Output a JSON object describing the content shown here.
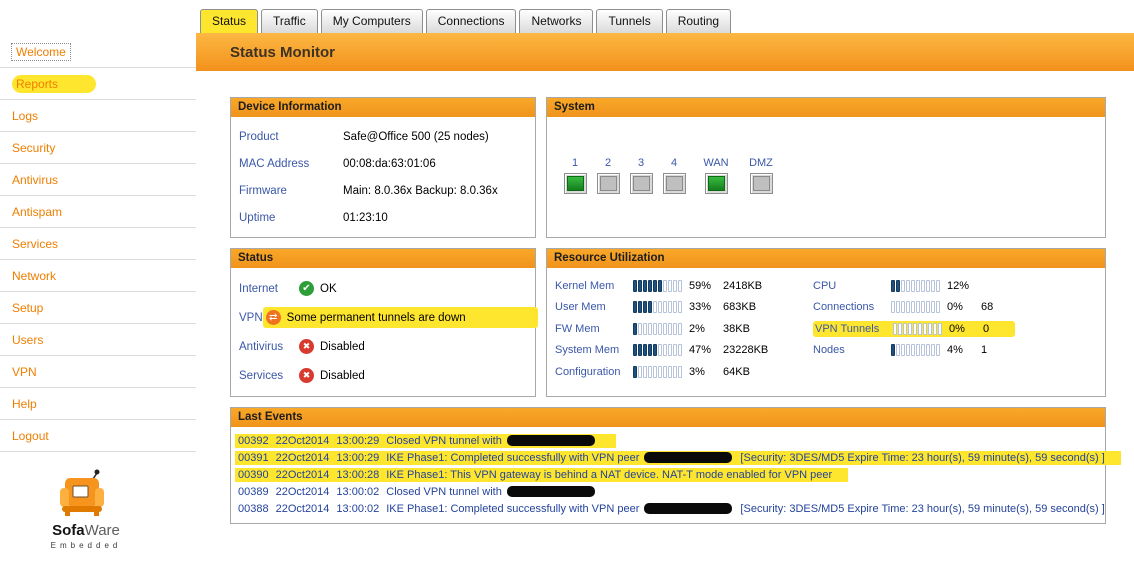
{
  "page_title": "Status Monitor",
  "sidebar": {
    "items": [
      {
        "label": "Welcome",
        "focused": true,
        "highlighted": false
      },
      {
        "label": "Reports",
        "focused": false,
        "highlighted": true
      },
      {
        "label": "Logs"
      },
      {
        "label": "Security"
      },
      {
        "label": "Antivirus"
      },
      {
        "label": "Antispam"
      },
      {
        "label": "Services"
      },
      {
        "label": "Network"
      },
      {
        "label": "Setup"
      },
      {
        "label": "Users"
      },
      {
        "label": "VPN"
      },
      {
        "label": "Help"
      },
      {
        "label": "Logout"
      }
    ],
    "logo": {
      "brand_bold": "Sofa",
      "brand_rest": "Ware",
      "subtitle": "Embedded"
    }
  },
  "tabs": [
    {
      "label": "Status",
      "active": true,
      "highlighted": true
    },
    {
      "label": "Traffic"
    },
    {
      "label": "My Computers"
    },
    {
      "label": "Connections"
    },
    {
      "label": "Networks"
    },
    {
      "label": "Tunnels"
    },
    {
      "label": "Routing"
    }
  ],
  "device_information": {
    "title": "Device Information",
    "rows": [
      {
        "label": "Product",
        "value": "Safe@Office 500 (25 nodes)"
      },
      {
        "label": "MAC Address",
        "value": "00:08:da:63:01:06"
      },
      {
        "label": "Firmware",
        "value": "Main: 8.0.36x Backup: 8.0.36x"
      },
      {
        "label": "Uptime",
        "value": "01:23:10"
      }
    ]
  },
  "system": {
    "title": "System",
    "ports": [
      {
        "label": "1",
        "active": true
      },
      {
        "label": "2",
        "active": false
      },
      {
        "label": "3",
        "active": false
      },
      {
        "label": "4",
        "active": false
      },
      {
        "label": "WAN",
        "active": true
      },
      {
        "label": "DMZ",
        "active": false
      }
    ]
  },
  "status": {
    "title": "Status",
    "rows": [
      {
        "label": "Internet",
        "icon": "check-circle-icon",
        "text": "OK",
        "highlighted": false
      },
      {
        "label": "VPN",
        "icon": "sync-circle-icon",
        "text": "Some permanent tunnels are down",
        "highlighted": true
      },
      {
        "label": "Antivirus",
        "icon": "x-circle-icon",
        "text": "Disabled",
        "highlighted": false
      },
      {
        "label": "Services",
        "icon": "x-circle-icon",
        "text": "Disabled",
        "highlighted": false
      }
    ]
  },
  "resource_utilization": {
    "title": "Resource Utilization",
    "left_column": [
      {
        "label": "Kernel Mem",
        "percent": 59,
        "value": "2418KB"
      },
      {
        "label": "User Mem",
        "percent": 33,
        "value": "683KB"
      },
      {
        "label": "FW Mem",
        "percent": 2,
        "value": "38KB"
      },
      {
        "label": "System Mem",
        "percent": 47,
        "value": "23228KB"
      },
      {
        "label": "Configuration",
        "percent": 3,
        "value": "64KB"
      }
    ],
    "right_column": [
      {
        "label": "CPU",
        "percent": 12,
        "value": ""
      },
      {
        "label": "Connections",
        "percent": 0,
        "value": "68"
      },
      {
        "label": "VPN Tunnels",
        "percent": 0,
        "value": "0",
        "highlighted": true
      },
      {
        "label": "Nodes",
        "percent": 4,
        "value": "1"
      }
    ]
  },
  "last_events": {
    "title": "Last Events",
    "rows": [
      {
        "id": "00392",
        "date": "22Oct2014",
        "time": "13:00:29",
        "message_before": "Closed VPN tunnel with",
        "redacted": true,
        "message_after": "",
        "highlighted": true
      },
      {
        "id": "00391",
        "date": "22Oct2014",
        "time": "13:00:29",
        "message_before": "IKE Phase1: Completed successfully with VPN peer",
        "redacted": true,
        "message_after": "[Security: 3DES/MD5 Expire Time: 23 hour(s), 59 minute(s), 59 second(s) ]",
        "highlighted": true
      },
      {
        "id": "00390",
        "date": "22Oct2014",
        "time": "13:00:28",
        "message_before": "IKE Phase1: This VPN gateway is behind a NAT device. NAT-T mode enabled for VPN peer",
        "redacted": false,
        "message_after": "",
        "highlighted": true
      },
      {
        "id": "00389",
        "date": "22Oct2014",
        "time": "13:00:02",
        "message_before": "Closed VPN tunnel with",
        "redacted": true,
        "message_after": "",
        "highlighted": false
      },
      {
        "id": "00388",
        "date": "22Oct2014",
        "time": "13:00:02",
        "message_before": "IKE Phase1: Completed successfully with VPN peer",
        "redacted": true,
        "message_after": "[Security: 3DES/MD5 Expire Time: 23 hour(s), 59 minute(s), 59 second(s) ]",
        "highlighted": false
      }
    ]
  },
  "colors": {
    "accent_orange": "#F7941E",
    "highlight_yellow": "#FFE62E",
    "status_ok_green": "#2E9E38",
    "status_warning_orange": "#EF7320",
    "status_error_red": "#D83A2E",
    "gauge_fill_blue": "#1C5180",
    "port_active_green": "#1F9C2D",
    "label_blue": "#3A57A8"
  }
}
